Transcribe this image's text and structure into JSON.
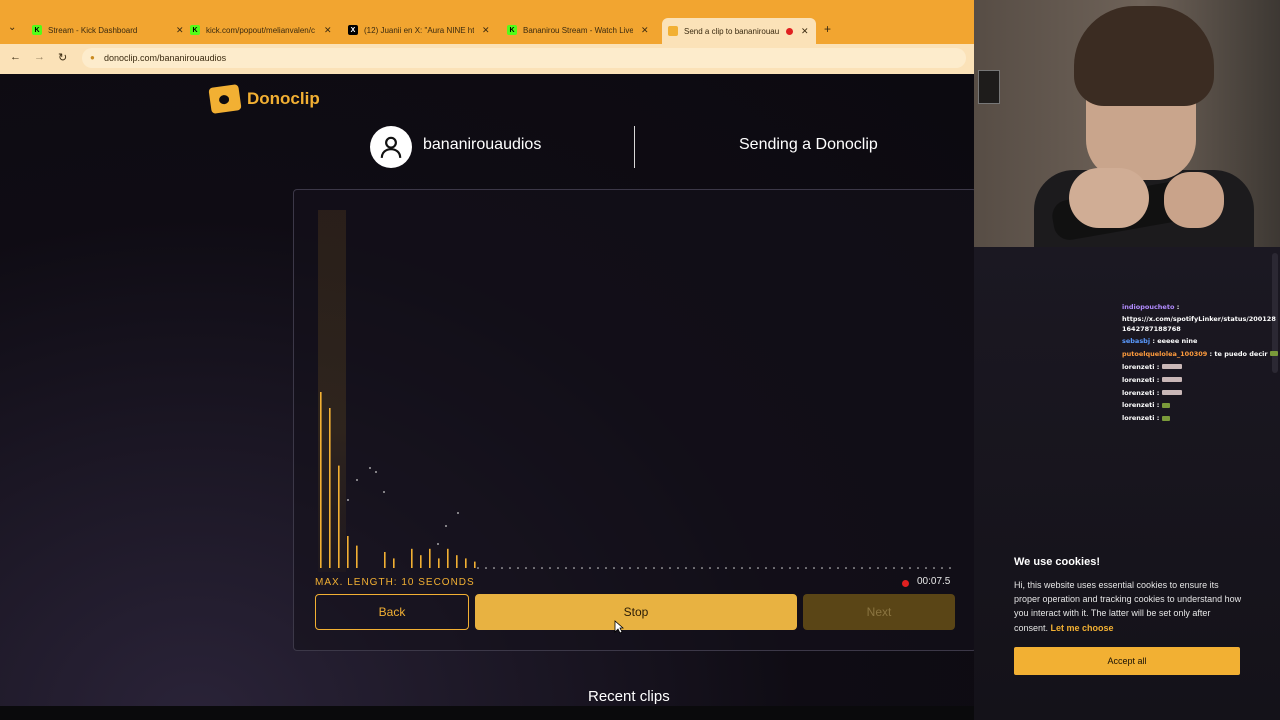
{
  "browser": {
    "tabs": [
      {
        "title": "Stream - Kick Dashboard",
        "favicon": "kick-icon",
        "color": "#53fc18"
      },
      {
        "title": "kick.com/popout/melianvalen/c",
        "favicon": "kick-icon",
        "color": "#53fc18"
      },
      {
        "title": "(12) Juanii en X: \"Aura NINE htt",
        "favicon": "x-icon",
        "color": "#000000"
      },
      {
        "title": "Bananirou Stream - Watch Live",
        "favicon": "kick-icon",
        "color": "#53fc18"
      },
      {
        "title": "Send a clip to bananirouau",
        "favicon": "donoclip-icon",
        "color": "#f2b033",
        "active": true
      }
    ],
    "url": "donoclip.com/bananirouaudios"
  },
  "page": {
    "logo_text": "Donoclip",
    "username": "bananirouaudios",
    "status_title": "Sending a Donoclip",
    "max_length": "MAX. LENGTH: 10 SECONDS",
    "timer": "00:07.5",
    "buttons": {
      "back": "Back",
      "stop": "Stop",
      "next": "Next"
    },
    "recent_title": "Recent clips"
  },
  "chat": {
    "messages": [
      {
        "user": "indiopoucheto",
        "text": ":"
      },
      {
        "user": "",
        "text": "https://x.com/spotifyLinker/status/2001281642787188768"
      },
      {
        "user": "sebasbj",
        "text": ": eeeee nine"
      },
      {
        "user": "putoelquelolea_100309",
        "text": ": te puedo decir"
      },
      {
        "user": "lorenzeti",
        "text": ":"
      },
      {
        "user": "lorenzeti",
        "text": ":"
      },
      {
        "user": "lorenzeti",
        "text": ":"
      },
      {
        "user": "lorenzeti",
        "text": ":"
      },
      {
        "user": "lorenzeti",
        "text": ":"
      }
    ]
  },
  "cookie": {
    "title": "We use cookies!",
    "text": "Hi, this website uses essential cookies to ensure its proper operation and tracking cookies to understand how you interact with it. The latter will be set only after consent.",
    "link": "Let me choose",
    "accept": "Accept all"
  },
  "colors": {
    "accent": "#f2b033",
    "record": "#e02020"
  },
  "audio_levels": [
    0.55,
    0.5,
    0.32,
    0.1,
    0.07,
    0.05,
    0.03,
    0.06,
    0.04,
    0.06,
    0.03,
    0.06,
    0.04,
    0.03,
    0.02
  ]
}
